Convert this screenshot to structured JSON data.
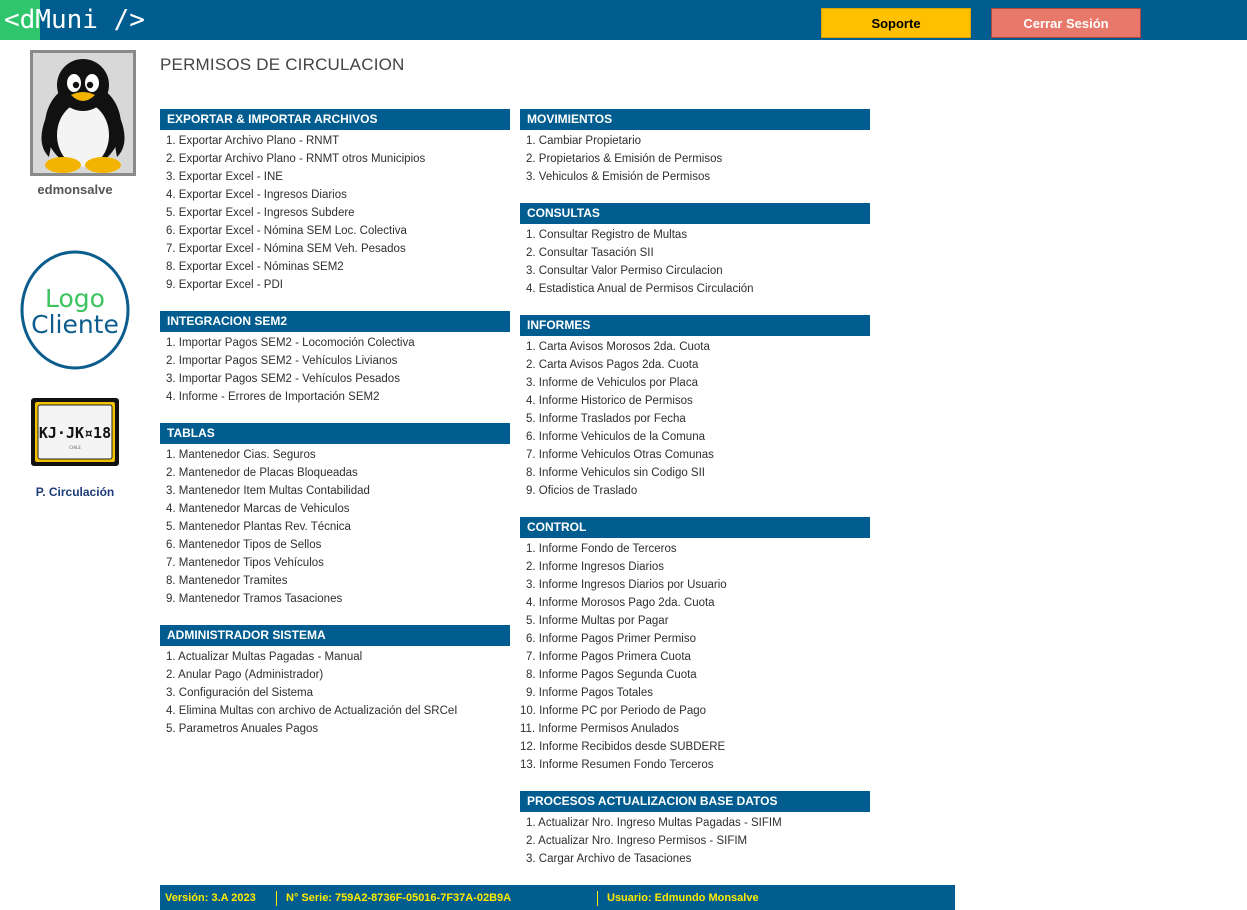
{
  "header": {
    "logo": "<dMuni />",
    "support_label": "Soporte",
    "logout_label": "Cerrar Sesión"
  },
  "user": {
    "name": "edmonsalve"
  },
  "client_logo": {
    "line1": "Logo",
    "line2": "Cliente"
  },
  "plate": {
    "text": "KJ·JK¤18",
    "small": "CHILE",
    "caption": "P. Circulación"
  },
  "page": {
    "title": "PERMISOS DE CIRCULACION"
  },
  "sections": {
    "export": {
      "title": "EXPORTAR & IMPORTAR ARCHIVOS",
      "items": [
        "1. Exportar Archivo Plano - RNMT",
        "2. Exportar Archivo Plano - RNMT otros Municipios",
        "3. Exportar Excel - INE",
        "4. Exportar Excel - Ingresos Diarios",
        "5. Exportar Excel - Ingresos Subdere",
        "6. Exportar Excel - Nómina SEM Loc. Colectiva",
        "7. Exportar Excel - Nómina SEM Veh. Pesados",
        "8. Exportar Excel - Nóminas SEM2",
        "9. Exportar Excel - PDI"
      ]
    },
    "sem2": {
      "title": "INTEGRACION SEM2",
      "items": [
        "1. Importar Pagos SEM2 - Locomoción Colectiva",
        "2. Importar Pagos SEM2 - Vehículos Livianos",
        "3. Importar Pagos SEM2 - Vehículos Pesados",
        "4. Informe - Errores de Importación SEM2"
      ]
    },
    "tablas": {
      "title": "TABLAS",
      "items": [
        "1. Mantenedor Cias. Seguros",
        "2. Mantenedor de Placas Bloqueadas",
        "3. Mantenedor Item Multas Contabilidad",
        "4. Mantenedor Marcas de Vehiculos",
        "5. Mantenedor Plantas Rev. Técnica",
        "6. Mantenedor Tipos de Sellos",
        "7. Mantenedor Tipos Vehículos",
        "8. Mantenedor Tramites",
        "9. Mantenedor Tramos Tasaciones"
      ]
    },
    "admin": {
      "title": "ADMINISTRADOR SISTEMA",
      "items": [
        "1. Actualizar Multas Pagadas - Manual",
        "2. Anular Pago (Administrador)",
        "3. Configuración del Sistema",
        "4. Elimina Multas con archivo de Actualización del SRCeI",
        "5. Parametros Anuales Pagos"
      ]
    },
    "movimientos": {
      "title": "MOVIMIENTOS",
      "items": [
        "1. Cambiar Propietario",
        "2. Propietarios & Emisión de Permisos",
        "3. Vehiculos & Emisión de Permisos"
      ]
    },
    "consultas": {
      "title": "CONSULTAS",
      "items": [
        "1. Consultar Registro de Multas",
        "2. Consultar Tasación SII",
        "3. Consultar Valor Permiso Circulacion",
        "4. Estadistica Anual de Permisos Circulación"
      ]
    },
    "informes": {
      "title": "INFORMES",
      "items": [
        "1. Carta Avisos Morosos 2da. Cuota",
        "2. Carta Avisos Pagos 2da. Cuota",
        "3. Informe de Vehiculos por Placa",
        "4. Informe Historico de Permisos",
        "5. Informe Traslados por Fecha",
        "6. Informe Vehiculos de la Comuna",
        "7. Informe Vehiculos Otras Comunas",
        "8. Informe Vehiculos sin Codigo SII",
        "9. Oficios de Traslado"
      ]
    },
    "control": {
      "title": "CONTROL",
      "items": [
        "1. Informe Fondo de Terceros",
        "2. Informe Ingresos Diarios",
        "3. Informe Ingresos Diarios por Usuario",
        "4. Informe Morosos Pago 2da. Cuota",
        "5. Informe Multas por Pagar",
        "6. Informe Pagos Primer Permiso",
        "7. Informe Pagos Primera Cuota",
        "8. Informe Pagos Segunda Cuota",
        "9. Informe Pagos Totales",
        "10. Informe PC por Periodo de Pago",
        "11. Informe Permisos Anulados",
        "12. Informe Recibidos desde SUBDERE",
        "13. Informe Resumen Fondo Terceros"
      ]
    },
    "procesos": {
      "title": "PROCESOS ACTUALIZACION BASE DATOS",
      "items": [
        "1. Actualizar Nro. Ingreso Multas Pagadas - SIFIM",
        "2. Actualizar Nro. Ingreso Permisos - SIFIM",
        "3. Cargar Archivo de Tasaciones"
      ]
    }
  },
  "footer": {
    "version": "Versión: 3.A 2023",
    "serial": "N° Serie: 759A2-8736F-05016-7F37A-02B9A",
    "user": "Usuario: Edmundo Monsalve"
  },
  "colors": {
    "primary": "#015d8f",
    "logo_green": "#2fc56c",
    "support_button": "#ffc000",
    "logout_button": "#e8796a",
    "footer_text": "#ffeb00"
  },
  "icons": [
    "penguin-avatar-icon",
    "license-plate-icon"
  ]
}
